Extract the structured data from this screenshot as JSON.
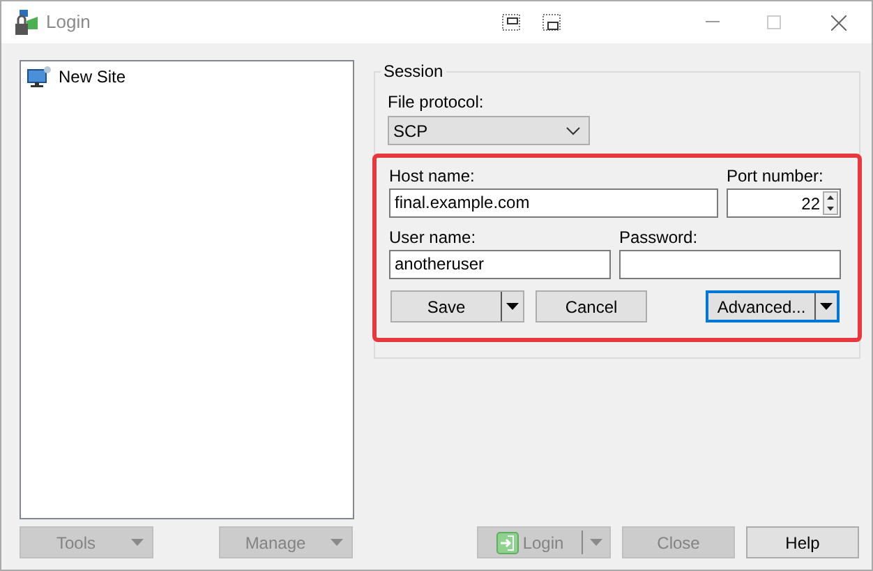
{
  "window": {
    "title": "Login"
  },
  "sites": [
    {
      "label": "New Site",
      "selected": false
    }
  ],
  "session": {
    "title": "Session",
    "file_protocol": {
      "label": "File protocol:",
      "value": "SCP"
    },
    "credentials": {
      "highlighted": true,
      "host": {
        "label": "Host name:",
        "value": "final.example.com"
      },
      "port": {
        "label": "Port number:",
        "value": "22"
      },
      "user": {
        "label": "User name:",
        "value": "anotheruser"
      },
      "password": {
        "label": "Password:"
      },
      "buttons": [
        {
          "label": "Save",
          "dropdown": true,
          "focused": false
        },
        {
          "label": "Cancel",
          "dropdown": false,
          "focused": false
        },
        {
          "label": "Advanced...",
          "dropdown": true,
          "focused": true
        }
      ]
    }
  },
  "left_buttons": [
    {
      "label": "Tools",
      "disabled": true
    },
    {
      "label": "Manage",
      "disabled": true
    }
  ],
  "right_buttons": [
    {
      "label": "Login",
      "disabled": true,
      "dropdown": true,
      "has_icon": true
    },
    {
      "label": "Close",
      "disabled": true,
      "dropdown": false,
      "has_icon": false
    },
    {
      "label": "Help",
      "disabled": false,
      "dropdown": false,
      "has_icon": false
    }
  ]
}
